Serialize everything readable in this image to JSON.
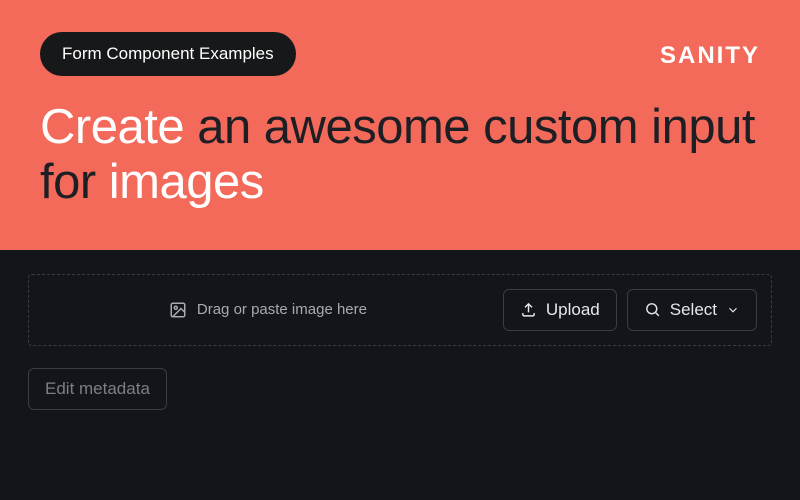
{
  "hero": {
    "pill_label": "Form Component Examples",
    "brand": "SANITY",
    "headline_part1": "Create",
    "headline_part2": " an awesome custom input for ",
    "headline_part3": "images"
  },
  "panel": {
    "drop_hint": "Drag or paste image here",
    "upload_label": "Upload",
    "select_label": "Select",
    "edit_metadata_label": "Edit metadata"
  },
  "colors": {
    "hero_bg": "#f36a5a",
    "panel_bg": "#14151a"
  }
}
